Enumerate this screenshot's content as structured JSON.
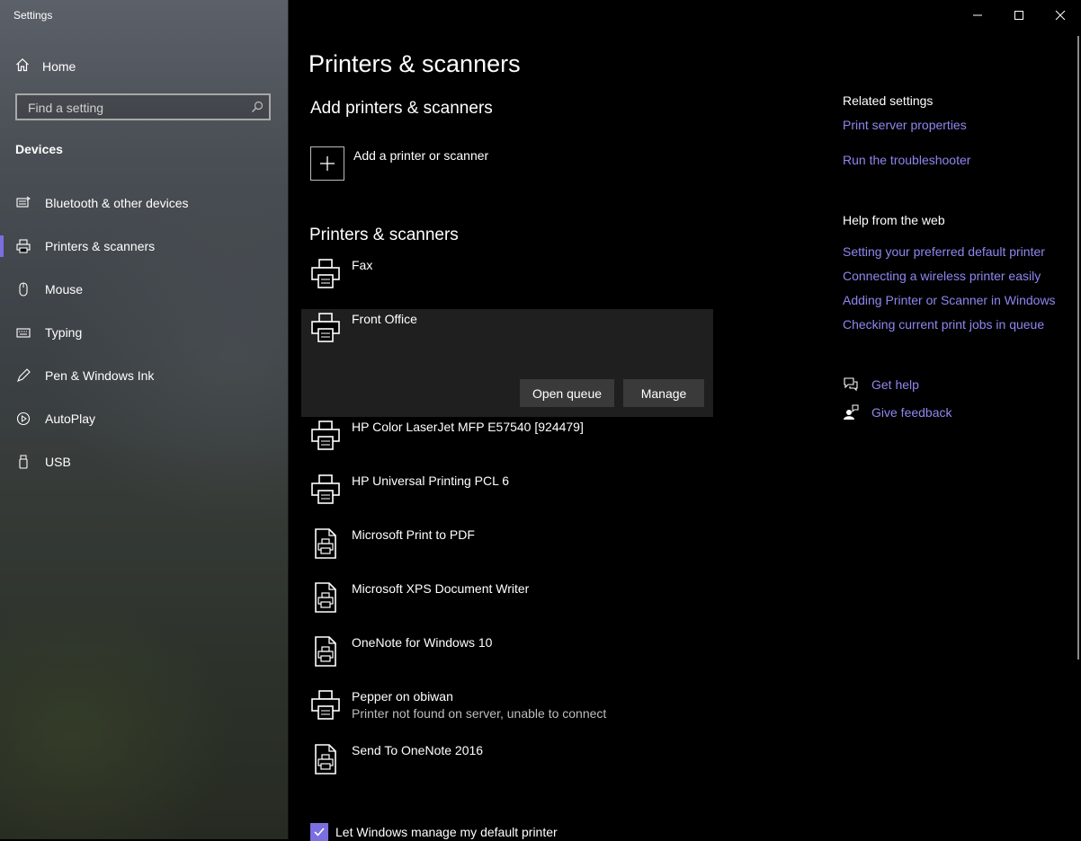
{
  "window": {
    "title": "Settings"
  },
  "sidebar": {
    "home_label": "Home",
    "search_placeholder": "Find a setting",
    "section_label": "Devices",
    "items": [
      {
        "label": "Bluetooth & other devices",
        "icon": "keyboard-bluetooth-icon"
      },
      {
        "label": "Printers & scanners",
        "icon": "printer-icon",
        "active": true
      },
      {
        "label": "Mouse",
        "icon": "mouse-icon"
      },
      {
        "label": "Typing",
        "icon": "keyboard-icon"
      },
      {
        "label": "Pen & Windows Ink",
        "icon": "pen-icon"
      },
      {
        "label": "AutoPlay",
        "icon": "autoplay-icon"
      },
      {
        "label": "USB",
        "icon": "usb-icon"
      }
    ]
  },
  "main": {
    "title": "Printers & scanners",
    "add_section_title": "Add printers & scanners",
    "add_label": "Add a printer or scanner",
    "list_section_title": "Printers & scanners",
    "printers": [
      {
        "name": "Fax",
        "status": "",
        "icon": "printer-icon"
      },
      {
        "name": "Front Office",
        "status": "",
        "icon": "printer-icon",
        "selected": true
      },
      {
        "name": "HP Color LaserJet MFP E57540 [924479]",
        "status": "",
        "icon": "printer-icon"
      },
      {
        "name": "HP Universal Printing PCL 6",
        "status": "",
        "icon": "printer-icon"
      },
      {
        "name": "Microsoft Print to PDF",
        "status": "",
        "icon": "document-printer-icon"
      },
      {
        "name": "Microsoft XPS Document Writer",
        "status": "",
        "icon": "document-printer-icon"
      },
      {
        "name": "OneNote for Windows 10",
        "status": "",
        "icon": "document-printer-icon"
      },
      {
        "name": "Pepper on obiwan",
        "status": "Printer not found on server, unable to connect",
        "icon": "printer-icon"
      },
      {
        "name": "Send To OneNote 2016",
        "status": "",
        "icon": "document-printer-icon"
      }
    ],
    "open_queue_label": "Open queue",
    "manage_label": "Manage",
    "default_printer_checkbox": {
      "label": "Let Windows manage my default printer",
      "checked": true
    }
  },
  "right": {
    "related_title": "Related settings",
    "related_links": [
      "Print server properties",
      "Run the troubleshooter"
    ],
    "help_title": "Help from the web",
    "help_links": [
      "Setting your preferred default printer",
      "Connecting a wireless printer easily",
      "Adding Printer or Scanner in Windows",
      "Checking current print jobs in queue"
    ],
    "get_help": "Get help",
    "give_feedback": "Give feedback"
  },
  "colors": {
    "accent": "#7b6ee0",
    "link": "#8f86f0",
    "selected_bg": "#1f1f1f",
    "button_bg": "#3a3a3a"
  }
}
